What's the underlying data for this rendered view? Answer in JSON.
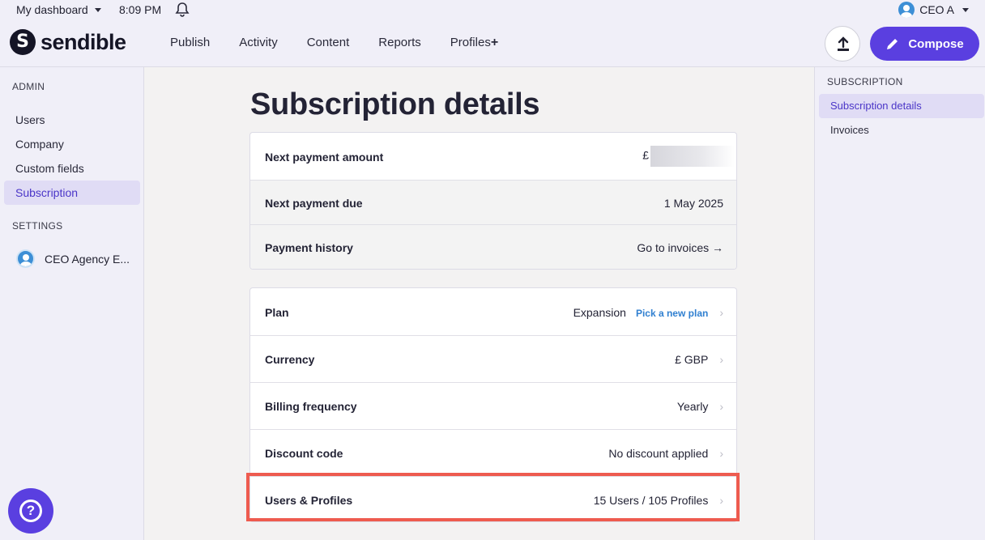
{
  "topbar": {
    "dashboard_label": "My dashboard",
    "time": "8:09 PM",
    "user_label": "CEO A",
    "logo_text": "sendible",
    "nav": [
      "Publish",
      "Activity",
      "Content",
      "Reports",
      "Profiles"
    ],
    "nav_profiles_plus": "+",
    "compose_label": "Compose"
  },
  "left_sidebar": {
    "admin_title": "ADMIN",
    "admin_items": [
      "Users",
      "Company",
      "Custom fields",
      "Subscription"
    ],
    "active_item": "Subscription",
    "settings_title": "SETTINGS",
    "agency_name": "CEO Agency E..."
  },
  "right_sidebar": {
    "title": "SUBSCRIPTION",
    "items": [
      "Subscription details",
      "Invoices"
    ],
    "active_item": "Subscription details"
  },
  "main": {
    "title": "Subscription details",
    "payment_card": {
      "next_payment_amount_label": "Next payment amount",
      "next_payment_amount_value": "£",
      "next_payment_due_label": "Next payment due",
      "next_payment_due_value": "1 May 2025",
      "payment_history_label": "Payment history",
      "payment_history_link": "Go to invoices",
      "payment_history_arrow": "→"
    },
    "plan_card": {
      "plan_label": "Plan",
      "plan_value": "Expansion",
      "plan_action": "Pick a new plan",
      "currency_label": "Currency",
      "currency_value": "£ GBP",
      "billing_label": "Billing frequency",
      "billing_value": "Yearly",
      "discount_label": "Discount code",
      "discount_value": "No discount applied",
      "users_label": "Users & Profiles",
      "users_value": "15 Users / 105 Profiles",
      "chevron": "›"
    }
  },
  "help_icon_glyph": "?",
  "colors": {
    "accent": "#5a3fe0",
    "link": "#2f7fd0",
    "highlight_border": "#ee5b4f"
  }
}
